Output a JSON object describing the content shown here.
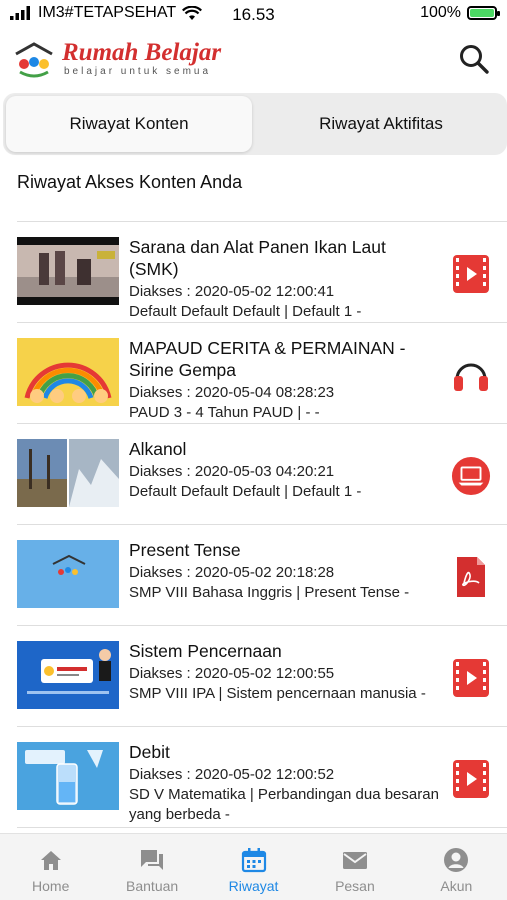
{
  "status_bar": {
    "carrier": "IM3#TETAPSEHAT",
    "time": "16.53",
    "battery": "100%",
    "battery_level": 1.0
  },
  "header": {
    "logo_title": "Rumah Belajar",
    "logo_subtitle": "belajar untuk semua"
  },
  "tabs": [
    {
      "label": "Riwayat Konten",
      "active": true
    },
    {
      "label": "Riwayat Aktifitas",
      "active": false
    }
  ],
  "section_title": "Riwayat Akses Konten Anda",
  "history_items": [
    {
      "title": "Sarana dan Alat Panen Ikan Laut (SMK)",
      "accessed": "Diakses : 2020-05-02 12:00:41",
      "category": "Default Default Default | Default 1 -",
      "type_icon": "video-icon"
    },
    {
      "title": "MAPAUD CERITA & PERMAINAN - Sirine Gempa",
      "accessed": "Diakses : 2020-05-04 08:28:23",
      "category": "PAUD 3 - 4 Tahun PAUD | - -",
      "type_icon": "headphones-icon"
    },
    {
      "title": "Alkanol",
      "accessed": "Diakses : 2020-05-03 04:20:21",
      "category": "Default Default Default | Default 1 -",
      "type_icon": "laptop-icon"
    },
    {
      "title": "Present Tense",
      "accessed": "Diakses : 2020-05-02 20:18:28",
      "category": "SMP VIII Bahasa Inggris | Present Tense -",
      "type_icon": "pdf-icon"
    },
    {
      "title": "Sistem Pencernaan",
      "accessed": "Diakses : 2020-05-02 12:00:55",
      "category": "SMP VIII IPA | Sistem pencernaan manusia -",
      "type_icon": "video-icon"
    },
    {
      "title": "Debit",
      "accessed": "Diakses : 2020-05-02 12:00:52",
      "category": "SD V Matematika | Perbandingan dua besaran yang berbeda -",
      "type_icon": "video-icon"
    }
  ],
  "bottom_nav": [
    {
      "label": "Home",
      "icon": "home-icon",
      "active": false
    },
    {
      "label": "Bantuan",
      "icon": "chat-icon",
      "active": false
    },
    {
      "label": "Riwayat",
      "icon": "calendar-icon",
      "active": true
    },
    {
      "label": "Pesan",
      "icon": "mail-icon",
      "active": false
    },
    {
      "label": "Akun",
      "icon": "account-icon",
      "active": false
    }
  ],
  "colors": {
    "accent_blue": "#1e88e5",
    "video_red": "#e53935",
    "brand_red": "#d32f2f"
  }
}
